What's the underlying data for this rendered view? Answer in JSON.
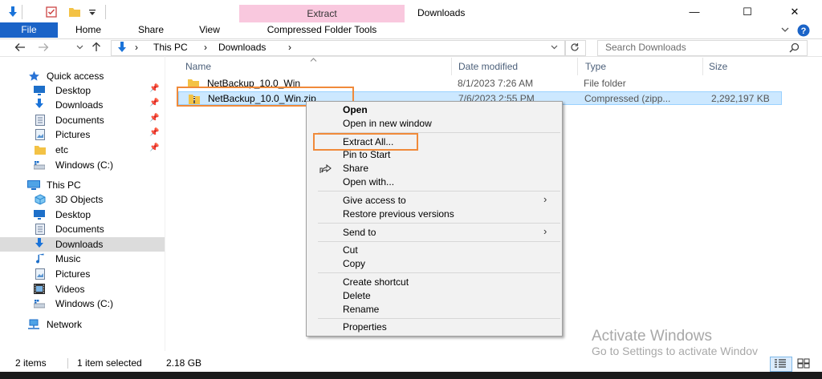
{
  "window": {
    "title": "Downloads",
    "context_tab": "Extract",
    "minimize": "—",
    "maximize": "☐",
    "close": "✕"
  },
  "ribbon": {
    "tabs": [
      "File",
      "Home",
      "Share",
      "View",
      "Compressed Folder Tools"
    ]
  },
  "address": {
    "crumbs": [
      "This PC",
      "Downloads"
    ],
    "search_placeholder": "Search Downloads"
  },
  "nav": {
    "quick_access": {
      "label": "Quick access",
      "items": [
        "Desktop",
        "Downloads",
        "Documents",
        "Pictures",
        "etc",
        "Windows (C:)"
      ]
    },
    "this_pc": {
      "label": "This PC",
      "items": [
        "3D Objects",
        "Desktop",
        "Documents",
        "Downloads",
        "Music",
        "Pictures",
        "Videos",
        "Windows (C:)"
      ]
    },
    "network": "Network"
  },
  "columns": {
    "name": "Name",
    "date": "Date modified",
    "type": "Type",
    "size": "Size"
  },
  "files": [
    {
      "name": "NetBackup_10.0_Win",
      "date": "8/1/2023 7:26 AM",
      "type": "File folder",
      "size": ""
    },
    {
      "name": "NetBackup_10.0_Win.zip",
      "date": "7/6/2023 2:55 PM",
      "type": "Compressed (zipp...",
      "size": "2,292,197 KB"
    }
  ],
  "context_menu": {
    "open": "Open",
    "open_new_window": "Open in new window",
    "extract_all": "Extract All...",
    "pin_to_start": "Pin to Start",
    "share": "Share",
    "open_with": "Open with...",
    "give_access": "Give access to",
    "restore_versions": "Restore previous versions",
    "send_to": "Send to",
    "cut": "Cut",
    "copy": "Copy",
    "create_shortcut": "Create shortcut",
    "delete": "Delete",
    "rename": "Rename",
    "properties": "Properties"
  },
  "status": {
    "items": "2 items",
    "selected": "1 item selected",
    "size": "2.18 GB"
  },
  "watermark": {
    "line1": "Activate Windows",
    "line2": "Go to Settings to activate Windov"
  },
  "colors": {
    "accent": "#1a63c7",
    "context_tab": "#f9c8de",
    "highlight_box": "#f08a3a",
    "selection": "#cce8ff"
  }
}
